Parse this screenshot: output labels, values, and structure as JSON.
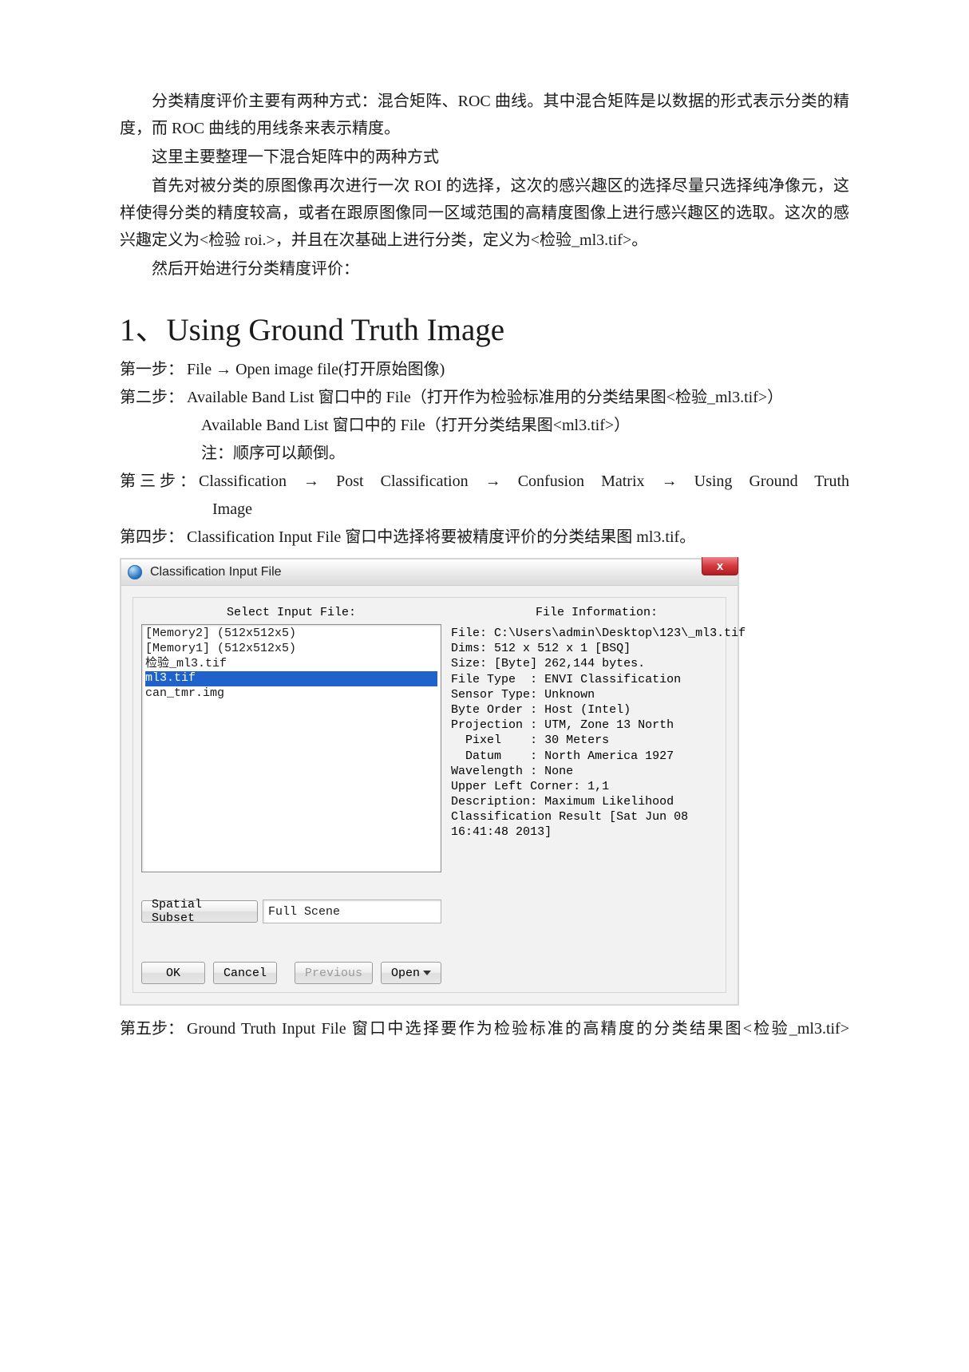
{
  "paragraphs": {
    "p1": "分类精度评价主要有两种方式：混合矩阵、ROC 曲线。其中混合矩阵是以数据的形式表示分类的精度，而 ROC 曲线的用线条来表示精度。",
    "p2": "这里主要整理一下混合矩阵中的两种方式",
    "p3": "首先对被分类的原图像再次进行一次 ROI 的选择，这次的感兴趣区的选择尽量只选择纯净像元，这样使得分类的精度较高，或者在跟原图像同一区域范围的高精度图像上进行感兴趣区的选取。这次的感兴趣定义为<检验 roi.>，并且在次基础上进行分类，定义为<检验_ml3.tif>。",
    "p4": "然后开始进行分类精度评价："
  },
  "heading": "1、Using Ground Truth Image",
  "steps": {
    "s1_label": "第一步：",
    "s1_body": "File → Open image file(打开原始图像)",
    "s2_label": "第二步：",
    "s2_body": "Available Band List 窗口中的 File（打开作为检验标准用的分类结果图<检验_ml3.tif>）",
    "s2_sub1": "Available Band List 窗口中的 File（打开分类结果图<ml3.tif>）",
    "s2_sub2": "注：顺序可以颠倒。",
    "s3_label": "第 三 步 ：",
    "s3_body_line1": "Classification  →  Post  Classification  →  Confusion  Matrix  →  Using  Ground  Truth",
    "s3_body_line2": "Image",
    "s4_label": "第四步：",
    "s4_body": "Classification Input File 窗口中选择将要被精度评价的分类结果图 ml3.tif。",
    "s5_label": "第五步：",
    "s5_body": "Ground Truth Input File 窗口中选择要作为检验标准的高精度的分类结果图<检验_ml3.tif>"
  },
  "dialog": {
    "title": "Classification Input File",
    "close_x": "x",
    "left_title": "Select Input File:",
    "right_title": "File Information:",
    "files": {
      "f0": "[Memory2] (512x512x5)",
      "f1": "[Memory1] (512x512x5)",
      "f2": "检验_ml3.tif",
      "f3": "ml3.tif",
      "f4": "can_tmr.img"
    },
    "info": "File: C:\\Users\\admin\\Desktop\\123\\_ml3.tif\nDims: 512 x 512 x 1 [BSQ]\nSize: [Byte] 262,144 bytes.\nFile Type  : ENVI Classification\nSensor Type: Unknown\nByte Order : Host (Intel)\nProjection : UTM, Zone 13 North\n  Pixel    : 30 Meters\n  Datum    : North America 1927\nWavelength : None\nUpper Left Corner: 1,1\nDescription: Maximum Likelihood\nClassification Result [Sat Jun 08\n16:41:48 2013]",
    "spatial_btn": "Spatial Subset",
    "spatial_value": "Full Scene",
    "ok": "OK",
    "cancel": "Cancel",
    "previous": "Previous",
    "open": "Open"
  }
}
